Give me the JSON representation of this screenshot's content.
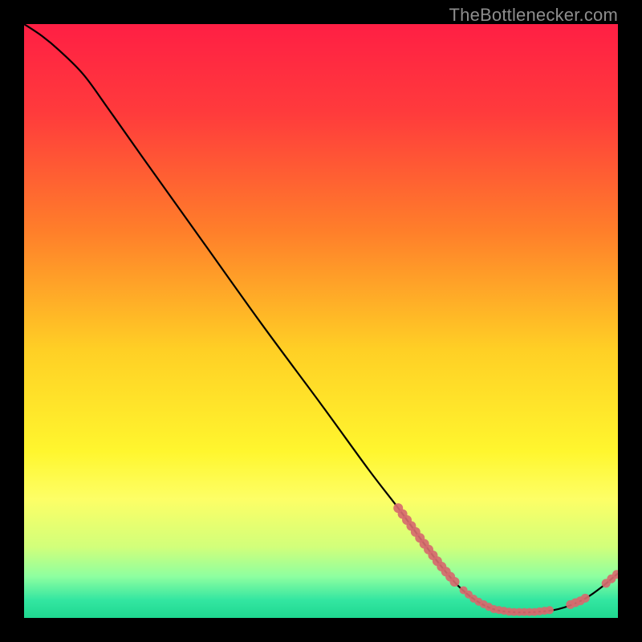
{
  "source_label": "TheBottlenecker.com",
  "chart_data": {
    "type": "line",
    "title": "",
    "xlabel": "",
    "ylabel": "",
    "xlim": [
      0,
      100
    ],
    "ylim": [
      0,
      100
    ],
    "gradient_stops": [
      {
        "pos": 0.0,
        "color": "#ff1f44"
      },
      {
        "pos": 0.15,
        "color": "#ff3b3c"
      },
      {
        "pos": 0.35,
        "color": "#ff7f2a"
      },
      {
        "pos": 0.55,
        "color": "#ffd025"
      },
      {
        "pos": 0.72,
        "color": "#fff62e"
      },
      {
        "pos": 0.8,
        "color": "#fdff66"
      },
      {
        "pos": 0.88,
        "color": "#d2ff7a"
      },
      {
        "pos": 0.93,
        "color": "#8effa0"
      },
      {
        "pos": 0.97,
        "color": "#33e6a1"
      },
      {
        "pos": 1.0,
        "color": "#1fd890"
      }
    ],
    "curve": [
      {
        "x": 0,
        "y": 100.0
      },
      {
        "x": 3,
        "y": 98.0
      },
      {
        "x": 6,
        "y": 95.5
      },
      {
        "x": 10,
        "y": 91.5
      },
      {
        "x": 14,
        "y": 86.0
      },
      {
        "x": 20,
        "y": 77.5
      },
      {
        "x": 30,
        "y": 63.5
      },
      {
        "x": 40,
        "y": 49.5
      },
      {
        "x": 50,
        "y": 36.0
      },
      {
        "x": 58,
        "y": 25.0
      },
      {
        "x": 63,
        "y": 18.5
      },
      {
        "x": 67,
        "y": 13.0
      },
      {
        "x": 70,
        "y": 9.0
      },
      {
        "x": 73,
        "y": 5.5
      },
      {
        "x": 76,
        "y": 3.0
      },
      {
        "x": 79,
        "y": 1.5
      },
      {
        "x": 82,
        "y": 1.0
      },
      {
        "x": 86,
        "y": 1.0
      },
      {
        "x": 90,
        "y": 1.5
      },
      {
        "x": 94,
        "y": 3.0
      },
      {
        "x": 97,
        "y": 5.0
      },
      {
        "x": 100,
        "y": 7.5
      }
    ],
    "marker_clusters": [
      {
        "start_x": 63.0,
        "end_x": 72.5,
        "y_offset": 0.0,
        "count": 14,
        "size": 6.0
      },
      {
        "start_x": 74.0,
        "end_x": 88.5,
        "y_offset": 0.0,
        "count": 18,
        "size": 5.0
      },
      {
        "start_x": 92.0,
        "end_x": 94.5,
        "y_offset": 0.0,
        "count": 4,
        "size": 5.5
      },
      {
        "start_x": 98.0,
        "end_x": 99.8,
        "y_offset": 0.0,
        "count": 3,
        "size": 5.5
      }
    ],
    "marker_color": "#d66a6e"
  }
}
